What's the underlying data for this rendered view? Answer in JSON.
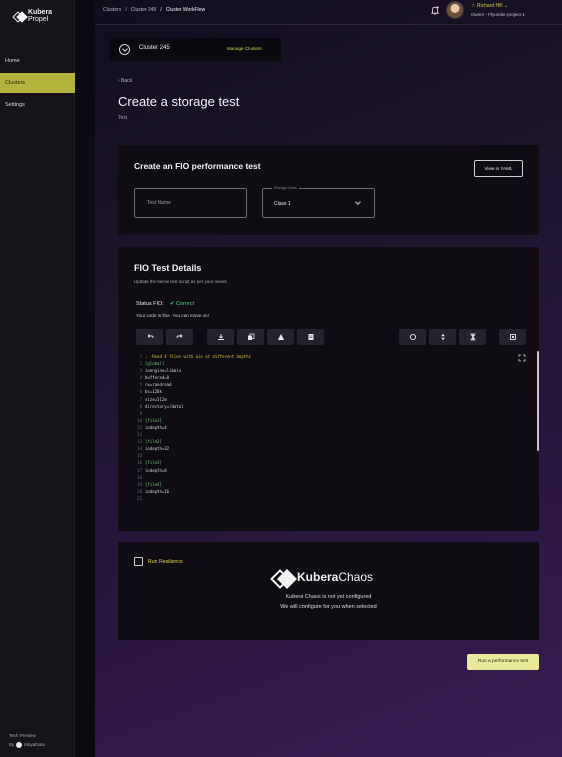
{
  "brand": {
    "name_bold": "Kubera",
    "name_light": "Propel"
  },
  "sidebar": {
    "items": [
      {
        "label": "Home"
      },
      {
        "label": "Clusters"
      },
      {
        "label": "Settings"
      }
    ],
    "footer": {
      "line1": "Tech Preview",
      "by": "By",
      "company": "MayaData"
    }
  },
  "topbar": {
    "breadcrumbs": [
      "Clusters",
      "/",
      "Cluster 245",
      "/",
      "Cluster WorkFlow"
    ],
    "user_name": "☆ Richard Hill ⌄",
    "user_org": "Owner - Flyunder-project-1"
  },
  "cluster_selector": {
    "name": "Cluster 245",
    "action": "Manage Clusters"
  },
  "page": {
    "back": "‹ Back",
    "title": "Create a storage test",
    "subtitle": "Text"
  },
  "fio_card": {
    "title": "Create an FIO performance test",
    "yaml_button": "View in YAML",
    "test_name_placeholder": "Test Name",
    "storage_class_legend": "Storage Class",
    "storage_class_value": "Class 1"
  },
  "details_card": {
    "title": "FIO Test Details",
    "description": "Update the below test script as per your needs",
    "status_label": "Status FIO:",
    "status_value": "✔ Correct",
    "status_message": "Your code is fine. You can move on!",
    "code_lines": [
      {
        "n": "1",
        "text": "; -Read 4 files with aio at different depths",
        "kind": "c"
      },
      {
        "n": "2",
        "text": "[global]",
        "kind": "s"
      },
      {
        "n": "3",
        "text": "ioengine=libaio",
        "kind": "t"
      },
      {
        "n": "4",
        "text": "buffered=0",
        "kind": "t"
      },
      {
        "n": "5",
        "text": "rw=randread",
        "kind": "t"
      },
      {
        "n": "6",
        "text": "bs=128k",
        "kind": "t"
      },
      {
        "n": "7",
        "text": "size=512m",
        "kind": "t"
      },
      {
        "n": "8",
        "text": "directory=/datal",
        "kind": "t"
      },
      {
        "n": "9",
        "text": "",
        "kind": "t"
      },
      {
        "n": "10",
        "text": "[file1]",
        "kind": "s"
      },
      {
        "n": "11",
        "text": "iodepth=4",
        "kind": "t"
      },
      {
        "n": "12",
        "text": "",
        "kind": "t"
      },
      {
        "n": "13",
        "text": "[file2]",
        "kind": "s"
      },
      {
        "n": "14",
        "text": "iodepth=32",
        "kind": "t"
      },
      {
        "n": "15",
        "text": "",
        "kind": "t"
      },
      {
        "n": "16",
        "text": "[file3]",
        "kind": "s"
      },
      {
        "n": "17",
        "text": "iodepth=8",
        "kind": "t"
      },
      {
        "n": "18",
        "text": "",
        "kind": "t"
      },
      {
        "n": "19",
        "text": "[file4]",
        "kind": "s"
      },
      {
        "n": "20",
        "text": "iodepth=16",
        "kind": "t"
      },
      {
        "n": "21",
        "text": "",
        "kind": "t"
      }
    ]
  },
  "resilience_card": {
    "checkbox_label": "Run Resilience",
    "logo_bold": "Kubera",
    "logo_light": "Chaos",
    "line1": "Kubera Chaos is not yet configured",
    "line2": "We will configure for you when selected"
  },
  "run_button": "Run a performance test",
  "colors": {
    "accent": "#b4b33e",
    "button_bg": "#e6ea9a",
    "success": "#4fd07a"
  }
}
